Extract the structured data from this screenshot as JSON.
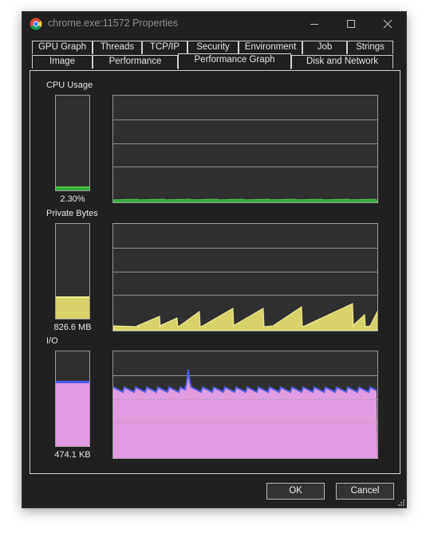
{
  "window": {
    "title": "chrome.exe:11572 Properties"
  },
  "tabs": {
    "row1": [
      "GPU Graph",
      "Threads",
      "TCP/IP",
      "Security",
      "Environment",
      "Job",
      "Strings"
    ],
    "row2": [
      "Image",
      "Performance",
      "Performance Graph",
      "Disk and Network"
    ],
    "active": "Performance Graph"
  },
  "sections": {
    "cpu": {
      "label": "CPU Usage",
      "value": "2.30%",
      "level": 0.023,
      "color": "#3aa53a"
    },
    "private": {
      "label": "Private Bytes",
      "value": "826.6 MB",
      "level": 0.22,
      "color": "#d8d26b"
    },
    "io": {
      "label": "I/O",
      "value": "474.1  KB",
      "level": 0.66,
      "color": "#e19be0",
      "accent": "#4d5ee8"
    }
  },
  "buttons": {
    "ok": "OK",
    "cancel": "Cancel"
  },
  "icons": {
    "app": "chrome-icon",
    "minimize": "minimize-icon",
    "maximize": "maximize-icon",
    "close": "close-icon",
    "grip": "resize-grip-icon"
  }
}
